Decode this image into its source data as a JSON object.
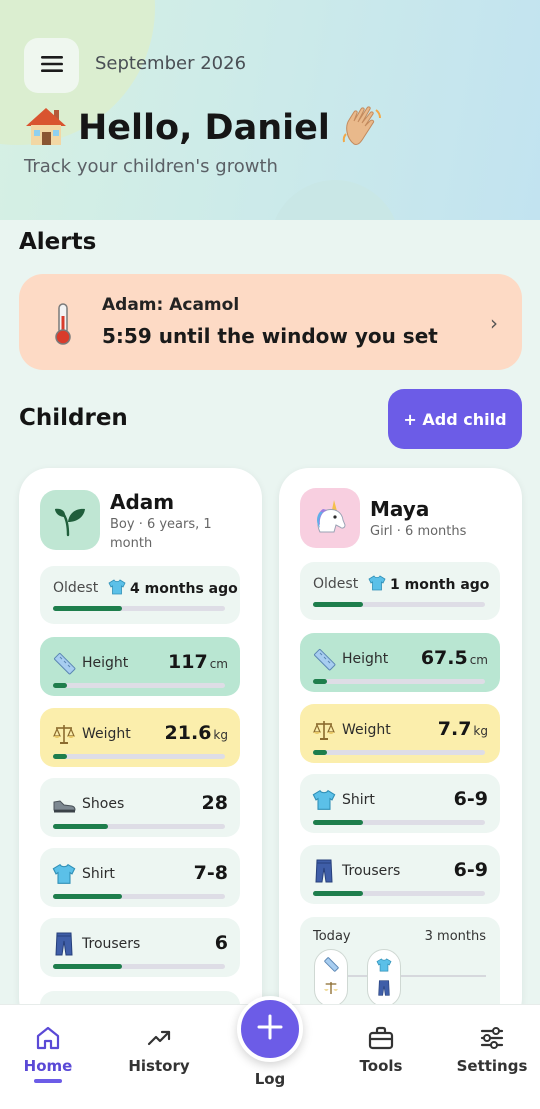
{
  "header": {
    "date": "September 2026",
    "greeting": "Hello, Daniel",
    "subtitle": "Track your children's growth"
  },
  "alerts": {
    "title": "Alerts",
    "items": [
      {
        "line1": "Adam: Acamol",
        "line2": "5:59 until the window you set",
        "icon": "thermometer-icon"
      }
    ]
  },
  "children_section": {
    "title": "Children",
    "add_button": "+ Add child"
  },
  "children": [
    {
      "name": "Adam",
      "meta": "Boy · 6 years, 1 month",
      "avatar": "sprout-icon",
      "oldest": {
        "label": "Oldest",
        "value": "4 months ago",
        "progress": 0.4
      },
      "metrics": [
        {
          "label": "Height",
          "value": "117",
          "unit": "cm",
          "icon": "ruler-icon",
          "progress": 0.08,
          "style": "green"
        },
        {
          "label": "Weight",
          "value": "21.6",
          "unit": "kg",
          "icon": "scale-icon",
          "progress": 0.08,
          "style": "yellow"
        },
        {
          "label": "Shoes",
          "value": "28",
          "unit": "",
          "icon": "shoe-icon",
          "progress": 0.32,
          "style": "plain"
        },
        {
          "label": "Shirt",
          "value": "7-8",
          "unit": "",
          "icon": "shirt-icon",
          "progress": 0.4,
          "style": "plain"
        },
        {
          "label": "Trousers",
          "value": "6",
          "unit": "",
          "icon": "trousers-icon",
          "progress": 0.4,
          "style": "plain"
        }
      ]
    },
    {
      "name": "Maya",
      "meta": "Girl · 6 months",
      "avatar": "unicorn-icon",
      "oldest": {
        "label": "Oldest",
        "value": "1 month ago",
        "progress": 0.29
      },
      "metrics": [
        {
          "label": "Height",
          "value": "67.5",
          "unit": "cm",
          "icon": "ruler-icon",
          "progress": 0.08,
          "style": "green"
        },
        {
          "label": "Weight",
          "value": "7.7",
          "unit": "kg",
          "icon": "scale-icon",
          "progress": 0.08,
          "style": "yellow"
        },
        {
          "label": "Shirt",
          "value": "6-9",
          "unit": "",
          "icon": "shirt-icon",
          "progress": 0.29,
          "style": "plain"
        },
        {
          "label": "Trousers",
          "value": "6-9",
          "unit": "",
          "icon": "trousers-icon",
          "progress": 0.29,
          "style": "plain"
        }
      ],
      "timeline": {
        "start": "Today",
        "end": "3 months"
      }
    }
  ],
  "nav": {
    "home": "Home",
    "history": "History",
    "log": "Log",
    "tools": "Tools",
    "settings": "Settings"
  },
  "colors": {
    "accent": "#6c5ce7",
    "progress": "#1e7e4c",
    "alert_bg": "#fddac5",
    "height_bg": "#b9e6d2",
    "weight_bg": "#fbeeac"
  }
}
